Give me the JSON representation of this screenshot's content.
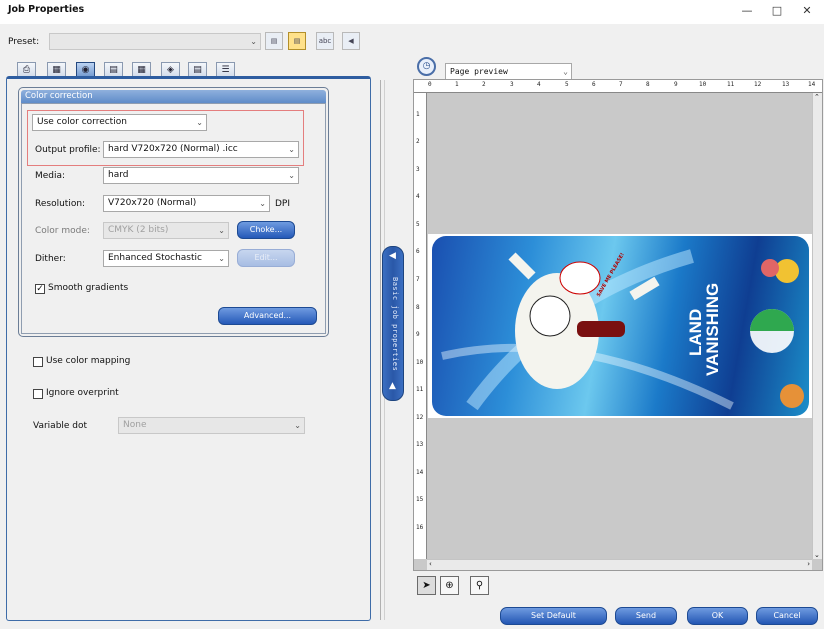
{
  "window": {
    "title": "Job Properties",
    "minimize_icon": "minimize-icon",
    "maximize_icon": "maximize-icon",
    "close_icon": "close-icon"
  },
  "preset": {
    "label": "Preset:",
    "value": ""
  },
  "preset_toolbar": [
    "save-preset-icon",
    "load-preset-icon",
    "abc-icon",
    "delete-preset-icon"
  ],
  "tabs": [
    "printer-tab-icon",
    "layout-tab-icon",
    "color-tab-icon",
    "finishing-tab-icon",
    "grid-tab-icon",
    "clip-tab-icon",
    "pages-tab-icon",
    "stack-tab-icon"
  ],
  "color_correction": {
    "title": "Color correction",
    "mode": "Use color correction",
    "output_profile_label": "Output profile:",
    "output_profile": "hard V720x720 (Normal) .icc",
    "media_label": "Media:",
    "media": "hard",
    "resolution_label": "Resolution:",
    "resolution": "V720x720 (Normal)",
    "resolution_unit": "DPI",
    "color_mode_label": "Color mode:",
    "color_mode": "CMYK (2 bits)",
    "choke_button": "Choke...",
    "dither_label": "Dither:",
    "dither": "Enhanced Stochastic",
    "edit_button": "Edit...",
    "smooth_gradients": "Smooth gradients",
    "smooth_gradients_checked": true,
    "advanced_button": "Advanced..."
  },
  "options": {
    "use_color_mapping": "Use color mapping",
    "ignore_overprint": "Ignore overprint",
    "variable_dot_label": "Variable dot",
    "variable_dot": "None"
  },
  "side_bar": {
    "label": "Basic job properties"
  },
  "preview": {
    "mode": "Page preview",
    "ruler_top": [
      "0",
      "1",
      "2",
      "3",
      "4",
      "5",
      "6",
      "7",
      "8",
      "9",
      "10",
      "11",
      "12",
      "13",
      "14"
    ],
    "ruler_left": [
      "1",
      "2",
      "3",
      "4",
      "5",
      "6",
      "7",
      "8",
      "9",
      "10",
      "11",
      "12",
      "13",
      "14",
      "15",
      "16"
    ],
    "art_title_1": "LAND",
    "art_title_2": "VANISHING",
    "art_bubble": "SAVE ME PLEASE!"
  },
  "footer": {
    "set_default": "Set Default",
    "send": "Send",
    "ok": "OK",
    "cancel": "Cancel"
  }
}
